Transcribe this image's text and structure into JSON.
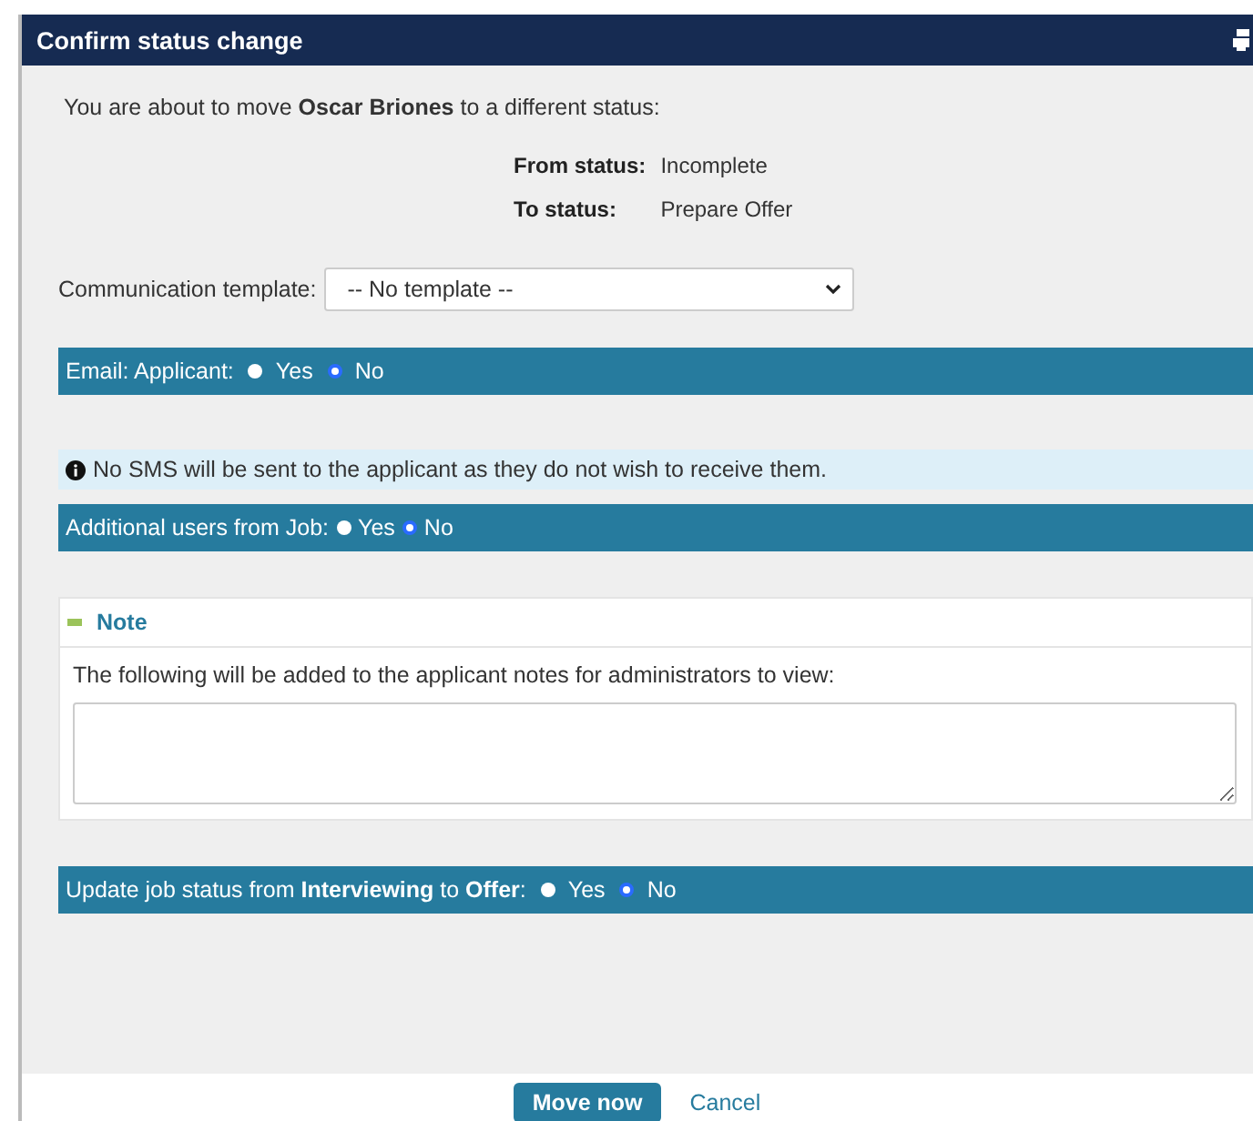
{
  "dialog": {
    "title": "Confirm status change"
  },
  "intro": "You are about to move **Oscar Briones** to a different status:",
  "status": [
    {
      "label": "From status:",
      "value": "Incomplete"
    },
    {
      "label": "To status:",
      "value": "Prepare Offer"
    }
  ],
  "template": {
    "label": "Communication template:",
    "value": "-- No template --"
  },
  "email_bar": {
    "label": "Email: Applicant:",
    "options": [
      {
        "label": "Yes",
        "selected": false
      },
      {
        "label": "No",
        "selected": true
      }
    ]
  },
  "sms_notice": "No SMS will be sent to the applicant as they do not wish to receive them.",
  "users_bar": {
    "label": "Additional users from Job:",
    "options": [
      {
        "label": "Yes",
        "selected": false
      },
      {
        "label": "No",
        "selected": true
      }
    ]
  },
  "note": {
    "title": "Note",
    "text": "The following will be added to the applicant notes for administrators to view:"
  },
  "job_bar": {
    "label": "Update job status from **Interviewing** to **Offer**:",
    "options": [
      {
        "label": "Yes",
        "selected": false
      },
      {
        "label": "No",
        "selected": true
      }
    ]
  },
  "buttons": {
    "primary": "Move now",
    "secondary": "Cancel"
  }
}
